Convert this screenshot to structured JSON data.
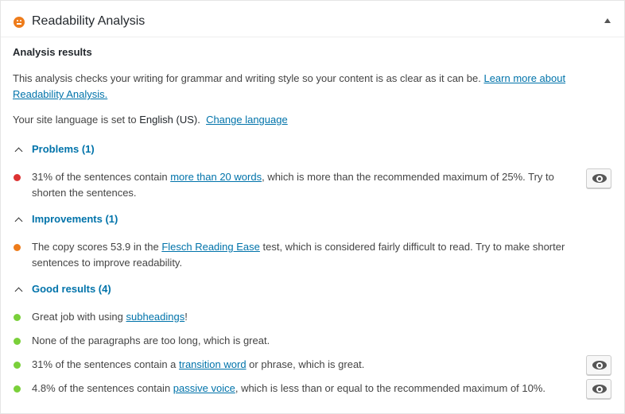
{
  "panel": {
    "title": "Readability Analysis"
  },
  "analysis": {
    "heading": "Analysis results",
    "intro_text": "This analysis checks your writing for grammar and writing style so your content is as clear as it can be. ",
    "intro_link": "Learn more about Readability Analysis.",
    "lang_prefix": "Your site language is set to ",
    "lang_value": "English (US).",
    "lang_link": "Change language"
  },
  "sections": {
    "problems": {
      "label": "Problems (1)",
      "items": [
        {
          "pre": "31% of the sentences contain ",
          "link": "more than 20 words",
          "post": ", which is more than the recommended maximum of 25%. Try to shorten the sentences.",
          "color": "#dc3232"
        }
      ]
    },
    "improvements": {
      "label": "Improvements (1)",
      "items": [
        {
          "pre": "The copy scores 53.9 in the ",
          "link": "Flesch Reading Ease",
          "post": " test, which is considered fairly difficult to read. Try to make shorter sentences to improve readability.",
          "color": "#ee7c1b"
        }
      ]
    },
    "good": {
      "label": "Good results (4)",
      "items": [
        {
          "pre": "Great job with using ",
          "link": "subheadings",
          "post": "!",
          "color": "#7ad03a"
        },
        {
          "pre": "None of the paragraphs are too long, which is great.",
          "link": "",
          "post": "",
          "color": "#7ad03a"
        },
        {
          "pre": "31% of the sentences contain a ",
          "link": "transition word",
          "post": " or phrase, which is great.",
          "color": "#7ad03a"
        },
        {
          "pre": "4.8% of the sentences contain ",
          "link": "passive voice",
          "post": ", which is less than or equal to the recommended maximum of 10%.",
          "color": "#7ad03a"
        }
      ]
    }
  },
  "icons": {
    "panel_icon": "smiley-icon",
    "eye": "eye-icon",
    "toggle": "chevron-up-icon",
    "collapse": "triangle-up-icon"
  }
}
